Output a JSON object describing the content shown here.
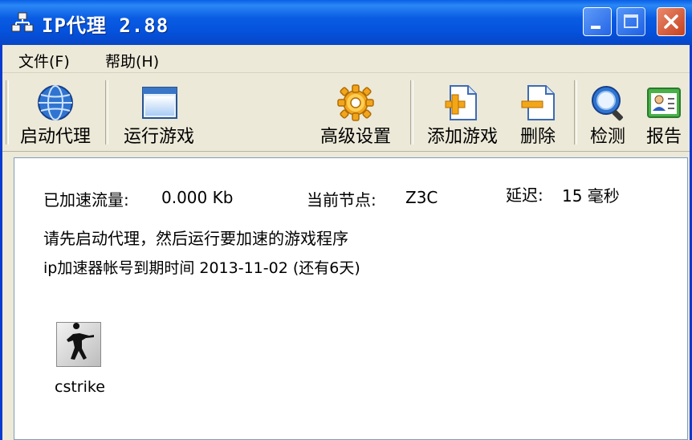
{
  "window": {
    "title": "IP代理 2.88"
  },
  "menu": [
    {
      "label": "文件(F)"
    },
    {
      "label": "帮助(H)"
    }
  ],
  "toolbar": [
    {
      "label": "启动代理",
      "icon": "globe-icon"
    },
    {
      "label": "运行游戏",
      "icon": "window-icon"
    },
    {
      "label": "高级设置",
      "icon": "gear-icon"
    },
    {
      "label": "添加游戏",
      "icon": "add-document-icon"
    },
    {
      "label": "删除",
      "icon": "remove-document-icon"
    },
    {
      "label": "检测",
      "icon": "magnifier-icon"
    },
    {
      "label": "报告",
      "icon": "report-icon"
    }
  ],
  "status": {
    "traffic_label": "已加速流量:",
    "traffic_value": "0.000 Kb",
    "node_label": "当前节点:",
    "node_value": "Z3C",
    "latency_label": "延迟:",
    "latency_value": "15 毫秒",
    "message": "请先启动代理，然后运行要加速的游戏程序",
    "expiry": "ip加速器帐号到期时间 2013-11-02 (还有6天)"
  },
  "games": [
    {
      "label": "cstrike",
      "icon": "counter-strike-icon"
    }
  ],
  "colors": {
    "titlebar": "#0552dc",
    "window_bg": "#ece9d8",
    "content_bg": "#ffffff",
    "close_button": "#c6401e"
  }
}
